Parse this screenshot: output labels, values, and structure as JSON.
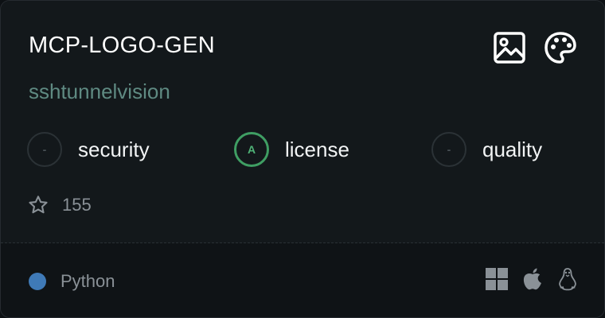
{
  "card": {
    "title": "MCP-LOGO-GEN",
    "owner": "sshtunnelvision",
    "top_icons": [
      "image-icon",
      "palette-icon"
    ],
    "badges": [
      {
        "grade": "-",
        "label": "security",
        "state": "none"
      },
      {
        "grade": "A",
        "label": "license",
        "state": "graded"
      },
      {
        "grade": "-",
        "label": "quality",
        "state": "none"
      }
    ],
    "stars": "155",
    "language": {
      "name": "Python",
      "color": "#3f7ab7"
    },
    "platforms": [
      "windows-icon",
      "apple-icon",
      "linux-icon"
    ]
  },
  "colors": {
    "background": "#13181b",
    "footer": "#0f1316",
    "owner_text": "#5f8a82",
    "grade_a": "#3f9e63"
  }
}
